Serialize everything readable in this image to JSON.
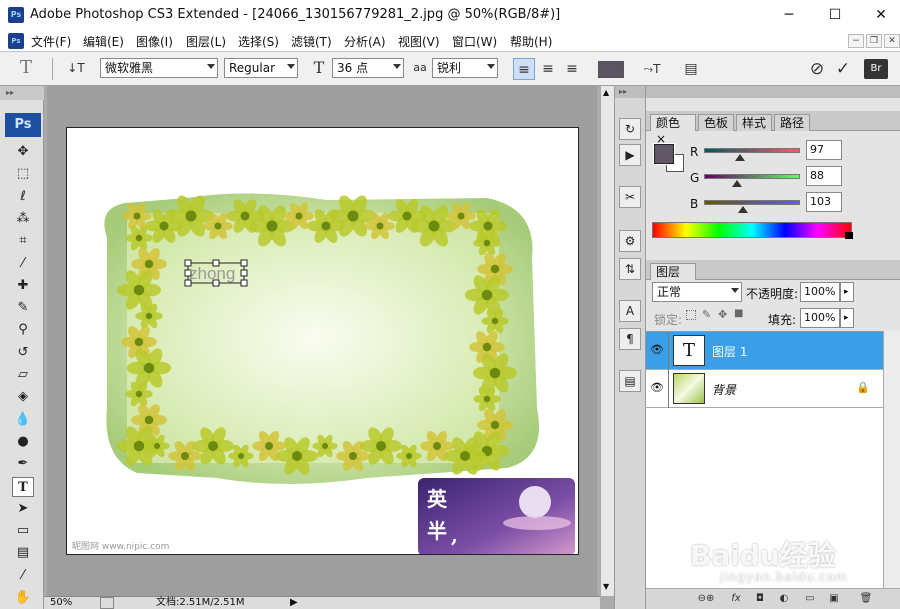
{
  "window": {
    "app_icon": "Ps",
    "title": "Adobe Photoshop CS3 Extended - [24066_130156779281_2.jpg @ 50%(RGB/8#)]",
    "minimize": "─",
    "maximize": "☐",
    "close": "✕"
  },
  "menu": {
    "items": [
      "文件(F)",
      "编辑(E)",
      "图像(I)",
      "图层(L)",
      "选择(S)",
      "滤镜(T)",
      "分析(A)",
      "视图(V)",
      "窗口(W)",
      "帮助(H)"
    ],
    "mdi_min": "−",
    "mdi_restore": "❐",
    "mdi_close": "✕"
  },
  "options_bar": {
    "tool_icon": "T",
    "orientation_icon": "↓T",
    "font_family": "微软雅黑",
    "font_style": "Regular",
    "size_icon": "T",
    "font_size": "36 点",
    "aa_icon": "aa",
    "antialias": "锐利",
    "align_left": "≡",
    "align_center": "≡",
    "align_right": "≡",
    "text_color": "#5a5560",
    "warp_icon": "⤳T",
    "palettes_icon": "▤",
    "cancel_icon": "⊘",
    "commit_icon": "✓",
    "bridge_icon": "Br"
  },
  "toolbox": {
    "grip": "▸▸",
    "ps_label": "Ps",
    "tools": [
      {
        "name": "move-tool",
        "glyph": "✥"
      },
      {
        "name": "marquee-tool",
        "glyph": "⬚"
      },
      {
        "name": "lasso-tool",
        "glyph": "ℓ"
      },
      {
        "name": "magic-wand-tool",
        "glyph": "⁂"
      },
      {
        "name": "crop-tool",
        "glyph": "⌗"
      },
      {
        "name": "eyedropper-tool",
        "glyph": "⁄"
      },
      {
        "name": "healing-brush-tool",
        "glyph": "✚"
      },
      {
        "name": "brush-tool",
        "glyph": "✎"
      },
      {
        "name": "clone-stamp-tool",
        "glyph": "⚲"
      },
      {
        "name": "history-brush-tool",
        "glyph": "↺"
      },
      {
        "name": "eraser-tool",
        "glyph": "▱"
      },
      {
        "name": "paint-bucket-tool",
        "glyph": "◈"
      },
      {
        "name": "blur-tool",
        "glyph": "💧"
      },
      {
        "name": "dodge-tool",
        "glyph": "●"
      },
      {
        "name": "pen-tool",
        "glyph": "✒"
      },
      {
        "name": "type-tool",
        "glyph": "T",
        "active": true
      },
      {
        "name": "path-selection-tool",
        "glyph": "➤"
      },
      {
        "name": "rectangle-tool",
        "glyph": "▭"
      },
      {
        "name": "notes-tool",
        "glyph": "▤"
      },
      {
        "name": "eyedropper2-tool",
        "glyph": "⁄"
      },
      {
        "name": "hand-tool",
        "glyph": "✋"
      }
    ]
  },
  "canvas": {
    "text_layer_value": "zhong",
    "watermark": "昵图网 www.nipic.com",
    "badge_text_1": "英",
    "badge_text_2": "半",
    "badge_text_3": ",",
    "colors": {
      "frame_bg": "#cfe6a8",
      "frame_center": "#eef6dc",
      "flower": "#b8c92a",
      "flower_dark": "#6a8a10",
      "badge_bg": "#4a2a78"
    }
  },
  "status_bar": {
    "zoom": "50%",
    "doc_info": "文档:2.51M/2.51M",
    "arrow": "▶"
  },
  "dock": {
    "buttons": [
      "↻",
      "▶",
      "✂",
      "⚙",
      "⇅",
      "A",
      "¶",
      "▤"
    ]
  },
  "color_panel": {
    "tabs": [
      "颜色",
      "色板",
      "样式",
      "路径"
    ],
    "close_icon": "×",
    "r_label": "R",
    "g_label": "G",
    "b_label": "B",
    "r_value": "97",
    "g_value": "88",
    "b_value": "103",
    "r_fraction": 0.38,
    "g_fraction": 0.345,
    "b_fraction": 0.404,
    "foreground": "#615867",
    "background": "#ffffff"
  },
  "layers_panel": {
    "tab": "图层",
    "close_icon": "×",
    "blend_mode": "正常",
    "opacity_label": "不透明度:",
    "opacity_value": "100%",
    "lock_label": "锁定:",
    "fill_label": "填充:",
    "fill_value": "100%",
    "flyout": "▸",
    "layers": [
      {
        "name": "图层 1",
        "thumb": "T",
        "selected": true
      },
      {
        "name": "背景",
        "thumb": "",
        "selected": false,
        "locked": true
      }
    ],
    "lock_icon": "🔒",
    "eye_icon": "👁",
    "footer_icons": [
      "⊖⊕",
      "fx",
      "◘",
      "◐",
      "▭",
      "▣",
      "🗑"
    ]
  },
  "watermark_overlay": {
    "brand": "Baidu经验",
    "url": "jingyan.baidu.com"
  }
}
